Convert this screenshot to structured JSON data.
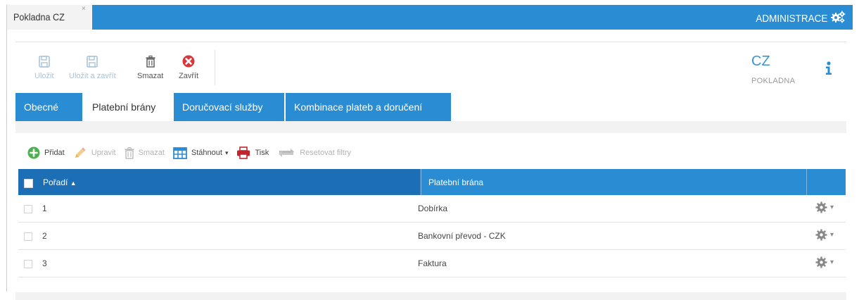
{
  "topbar": {
    "document_tab": "Pokladna CZ",
    "close_glyph": "×",
    "admin_label": "ADMINISTRACE"
  },
  "toolbar": {
    "save_label": "Uložit",
    "save_close_label": "Uložit a zavřít",
    "delete_label": "Smazat",
    "close_label": "Zavřít"
  },
  "header": {
    "code": "CZ",
    "subtitle": "POKLADNA"
  },
  "tabs": [
    {
      "label": "Obecné",
      "active": false
    },
    {
      "label": "Platební brány",
      "active": true
    },
    {
      "label": "Doručovací služby",
      "active": false
    },
    {
      "label": "Kombinace plateb a doručení",
      "active": false
    }
  ],
  "grid_toolbar": {
    "add_label": "Přidat",
    "edit_label": "Upravit",
    "delete_label": "Smazat",
    "download_label": "Stáhnout",
    "print_label": "Tisk",
    "reset_label": "Resetovat filtry"
  },
  "table": {
    "columns": [
      "Pořadí",
      "Platební brána"
    ],
    "sort_indicator": "▲",
    "rows": [
      {
        "poradi": "1",
        "brana": "Dobírka"
      },
      {
        "poradi": "2",
        "brana": "Bankovní převod - CZK"
      },
      {
        "poradi": "3",
        "brana": "Faktura"
      }
    ]
  },
  "colors": {
    "accent": "#2a8dd4",
    "header_dark": "#1d6fb5",
    "delete_red": "#d9363e",
    "add_green": "#4caf50"
  }
}
